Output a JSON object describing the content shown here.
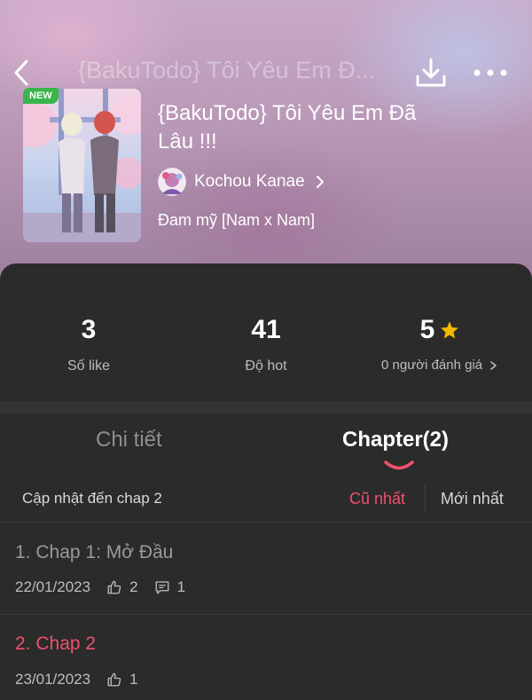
{
  "header": {
    "title_faded": "{BakuTodo} Tôi Yêu Em Đ..."
  },
  "book": {
    "badge": "NEW",
    "title": "{BakuTodo} Tôi Yêu Em Đã Lâu !!!",
    "author": "Kochou Kanae",
    "genre": "Đam mỹ [Nam x Nam]"
  },
  "stats": {
    "likes_value": "3",
    "likes_label": "Số like",
    "hot_value": "41",
    "hot_label": "Độ hot",
    "rating_value": "5",
    "rating_label": "0 người đánh giá"
  },
  "tabs": {
    "details": "Chi tiết",
    "chapters": "Chapter(2)"
  },
  "chapter_list": {
    "update_text": "Cập nhật đến chap 2",
    "sort_oldest": "Cũ nhất",
    "sort_newest": "Mới nhất",
    "items": [
      {
        "title": "1. Chap 1: Mở Đầu",
        "date": "22/01/2023",
        "likes": "2",
        "comments": "1"
      },
      {
        "title": "2. Chap 2",
        "date": "23/01/2023",
        "likes": "1"
      }
    ]
  },
  "colors": {
    "accent": "#f0516f",
    "star": "#f5b800",
    "badge": "#39b54a"
  }
}
